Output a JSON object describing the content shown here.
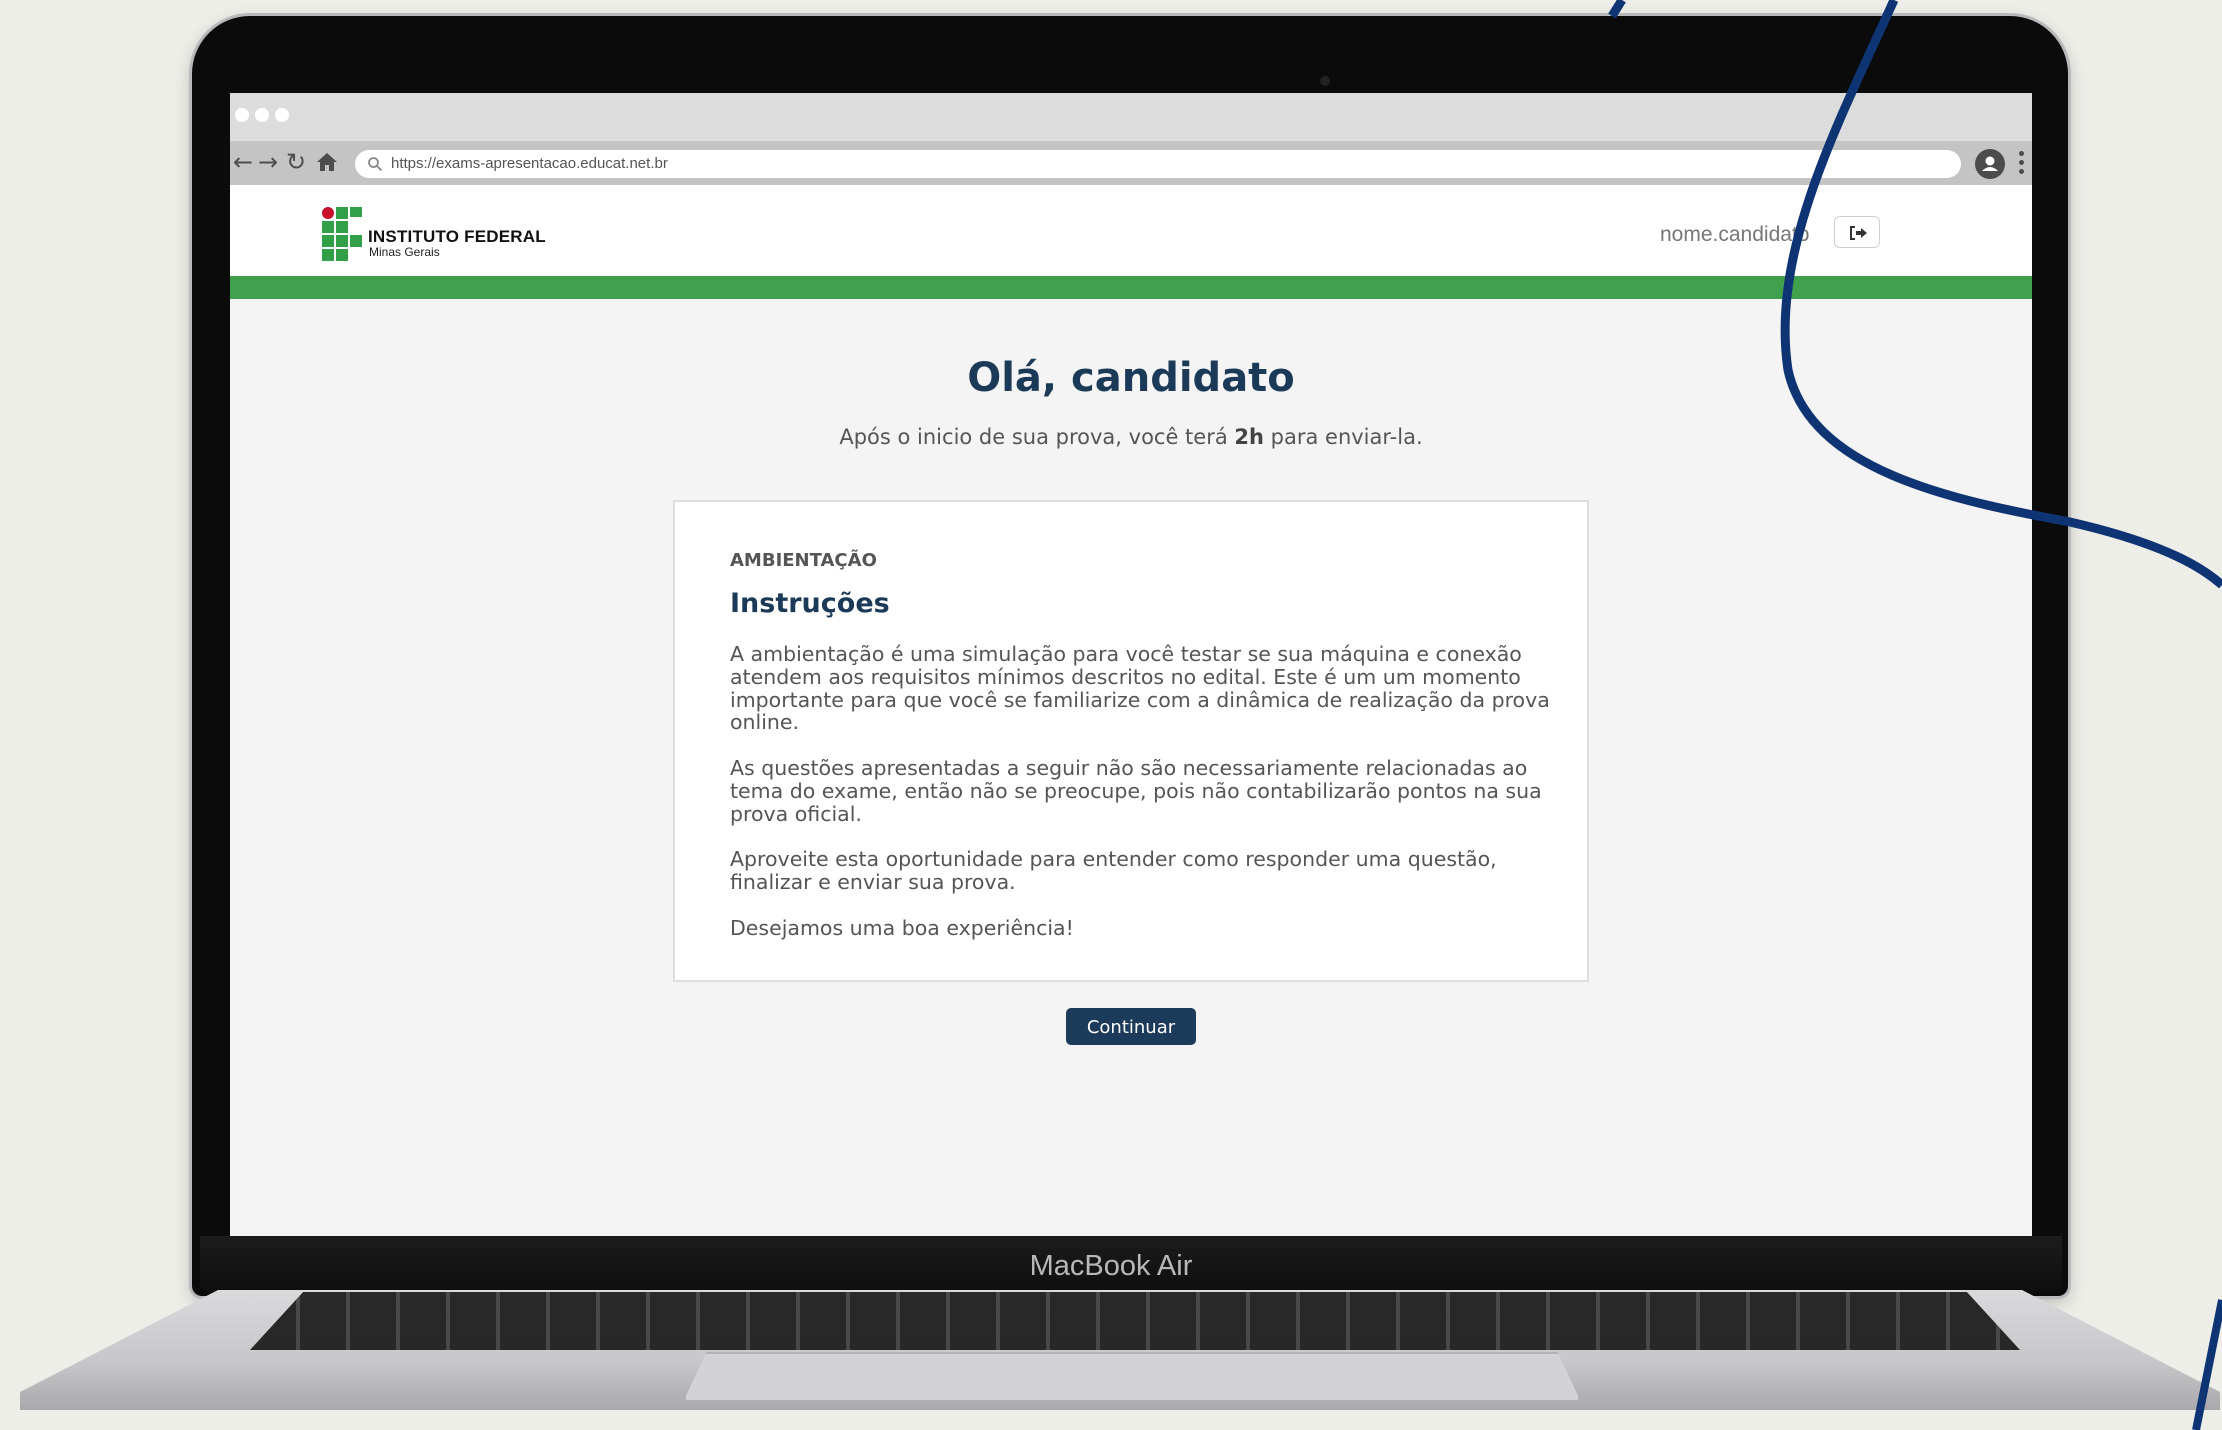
{
  "device": {
    "label": "MacBook Air"
  },
  "browser": {
    "url": "https://exams-apresentacao.educat.net.br",
    "icons": [
      "back-icon",
      "forward-icon",
      "reload-icon",
      "home-icon",
      "search-icon",
      "profile-icon",
      "kebab-menu-icon"
    ]
  },
  "header": {
    "logo_title": "INSTITUTO FEDERAL",
    "logo_subtitle": "Minas Gerais",
    "username": "nome.candidato"
  },
  "main": {
    "title": "Olá, candidato",
    "subtitle_before": "Após o inicio de sua prova, você terá ",
    "subtitle_bold": "2h",
    "subtitle_after": " para enviar-la."
  },
  "card": {
    "label": "AMBIENTAÇÃO",
    "title": "Instruções",
    "paragraphs": [
      "A ambientação é uma simulação para você testar se sua máquina e conexão atendem aos requisitos mínimos descritos no edital. Este é um um momento importante para que você se familiarize com a dinâmica de realização da prova online.",
      "As questões apresentadas a seguir não são necessariamente relacionadas ao tema do exame, então não se preocupe, pois não contabilizarão pontos na sua prova oficial.",
      "Aproveite esta oportunidade para entender como responder uma questão, finalizar e enviar sua prova.",
      "Desejamos uma boa experiência!"
    ],
    "button_label": "Continuar"
  },
  "colors": {
    "brand_green": "#3fa04e",
    "navy": "#1b3a57",
    "logo_red": "#c8102e"
  }
}
